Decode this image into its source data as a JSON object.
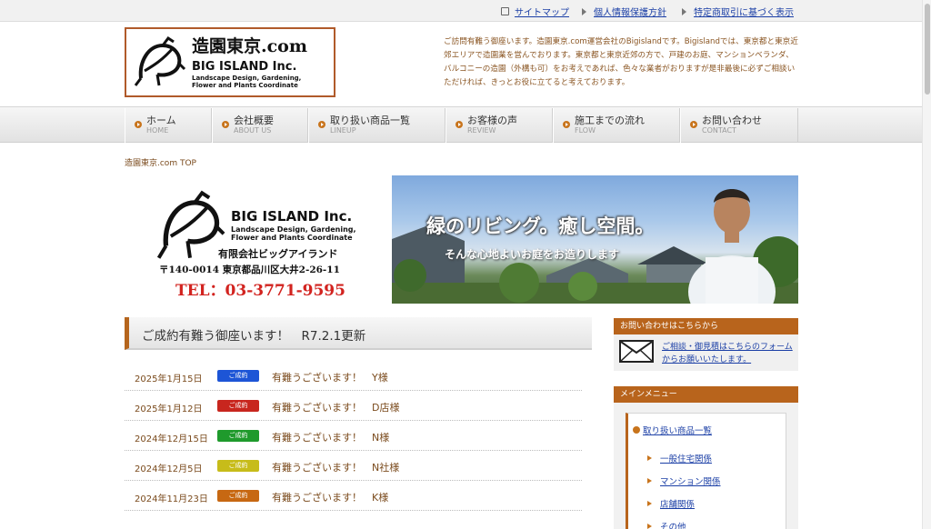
{
  "topbar": {
    "links": [
      {
        "label": "サイトマップ",
        "icon": "sitemap-icon"
      },
      {
        "label": "個人情報保護方針",
        "icon": "arrow-icon"
      },
      {
        "label": "特定商取引に基づく表示",
        "icon": "arrow-icon"
      }
    ]
  },
  "header": {
    "logo_title": "造園東京.com",
    "logo_company": "BIG ISLAND Inc.",
    "logo_sub1": "Landscape Design, Gardening,",
    "logo_sub2": "Flower and Plants Coordinate",
    "intro": "ご訪問有難う御座います。造園東京.com運営会社のBigislandです。Bigislandでは、東京都と東京近郊エリアで造園業を営んでおります。東京都と東京近郊の方で、戸建のお庭、マンションベランダ、バルコニーの造園（外構も可）をお考えであれば、色々な業者がおりますが是非最後に必ずご相談いただければ、きっとお役に立てると考えております。"
  },
  "nav": {
    "items": [
      {
        "jp": "ホーム",
        "en": "HOME"
      },
      {
        "jp": "会社概要",
        "en": "ABOUT US"
      },
      {
        "jp": "取り扱い商品一覧",
        "en": "LINEUP"
      },
      {
        "jp": "お客様の声",
        "en": "REVIEW"
      },
      {
        "jp": "施工までの流れ",
        "en": "FLOW"
      },
      {
        "jp": "お問い合わせ",
        "en": "CONTACT"
      }
    ]
  },
  "breadcrumb": "造園東京.com TOP",
  "hero": {
    "company": "BIG ISLAND Inc.",
    "sub1": "Landscape Design, Gardening,",
    "sub2": "Flower and Plants Coordinate",
    "name": "有限会社ビッグアイランド",
    "address": "〒140-0014 東京都品川区大井2-26-11",
    "tel": "TEL：03-3771-9595",
    "catch": "緑のリビング。癒し空間。",
    "catch2": "そんな心地よいお庭をお造りします"
  },
  "news": {
    "title": "ご成約有難う御座います！　R7.2.1更新",
    "items": [
      {
        "date": "2025年1月15日",
        "badge": "ご成約",
        "color": "#1d55d6",
        "text": "有難うございます！　Y様"
      },
      {
        "date": "2025年1月12日",
        "badge": "ご成約",
        "color": "#c8261e",
        "text": "有難うございます！　D店様"
      },
      {
        "date": "2024年12月15日",
        "badge": "ご成約",
        "color": "#1f9a2c",
        "text": "有難うございます！　N様"
      },
      {
        "date": "2024年12月5日",
        "badge": "ご成約",
        "color": "#c7bc1a",
        "text": "有難うございます！　N社様"
      },
      {
        "date": "2024年11月23日",
        "badge": "ご成約",
        "color": "#c76812",
        "text": "有難うございます！　K様"
      }
    ]
  },
  "side": {
    "contact_head": "お問い合わせはこちらから",
    "contact_link": "ご相談・御見積はこちらのフォームからお願いいたします。",
    "menu_head": "メインメニュー",
    "menu_main": "取り扱い商品一覧",
    "menu_subs": [
      "一般住宅関係",
      "マンション関係",
      "店舗関係",
      "その他"
    ]
  }
}
